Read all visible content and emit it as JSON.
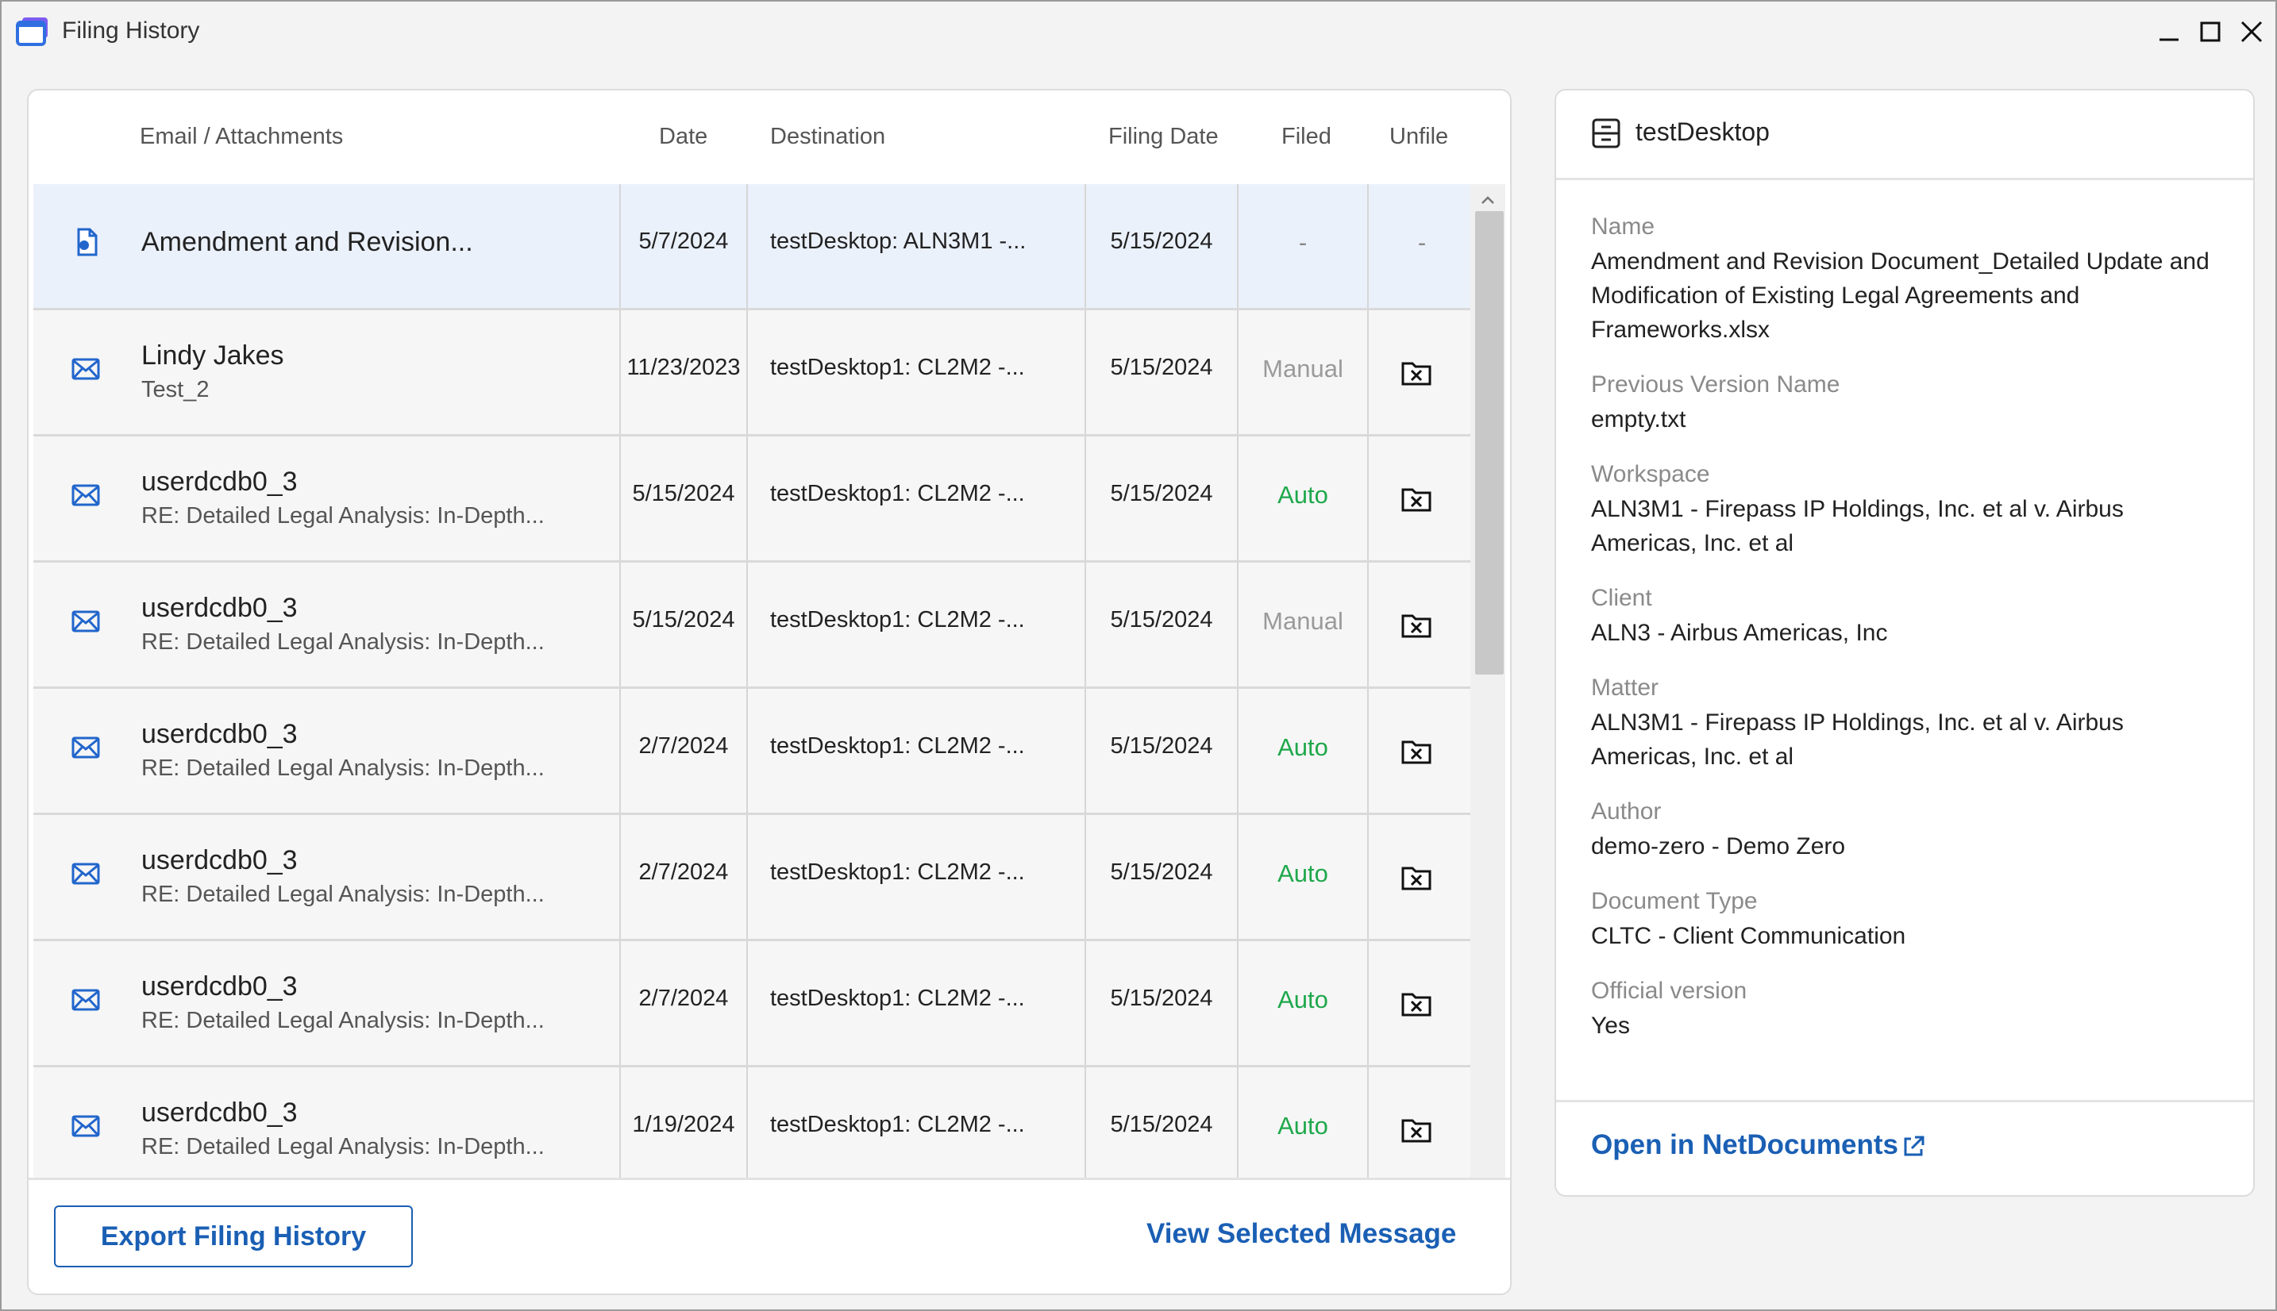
{
  "window": {
    "title": "Filing History"
  },
  "table": {
    "headers": {
      "email": "Email / Attachments",
      "date": "Date",
      "destination": "Destination",
      "filing_date": "Filing Date",
      "filed": "Filed",
      "unfile": "Unfile"
    },
    "rows": [
      {
        "type": "document",
        "name": "Amendment and Revision...",
        "sub": "",
        "date": "5/7/2024",
        "destination": "testDesktop: ALN3M1 -...",
        "filing_date": "5/15/2024",
        "filed": "-",
        "unfile": "-",
        "selected": true
      },
      {
        "type": "email",
        "name": "Lindy Jakes",
        "sub": "Test_2",
        "date": "11/23/2023",
        "destination": "testDesktop1: CL2M2 -...",
        "filing_date": "5/15/2024",
        "filed": "Manual",
        "unfile": "icon"
      },
      {
        "type": "email",
        "name": "userdcdb0_3",
        "sub": "RE: Detailed Legal Analysis: In-Depth...",
        "date": "5/15/2024",
        "destination": "testDesktop1: CL2M2 -...",
        "filing_date": "5/15/2024",
        "filed": "Auto",
        "unfile": "icon"
      },
      {
        "type": "email",
        "name": "userdcdb0_3",
        "sub": "RE: Detailed Legal Analysis: In-Depth...",
        "date": "5/15/2024",
        "destination": "testDesktop1: CL2M2 -...",
        "filing_date": "5/15/2024",
        "filed": "Manual",
        "unfile": "icon"
      },
      {
        "type": "email",
        "name": "userdcdb0_3",
        "sub": "RE: Detailed Legal Analysis: In-Depth...",
        "date": "2/7/2024",
        "destination": "testDesktop1: CL2M2 -...",
        "filing_date": "5/15/2024",
        "filed": "Auto",
        "unfile": "icon"
      },
      {
        "type": "email",
        "name": "userdcdb0_3",
        "sub": "RE: Detailed Legal Analysis: In-Depth...",
        "date": "2/7/2024",
        "destination": "testDesktop1: CL2M2 -...",
        "filing_date": "5/15/2024",
        "filed": "Auto",
        "unfile": "icon"
      },
      {
        "type": "email",
        "name": "userdcdb0_3",
        "sub": "RE: Detailed Legal Analysis: In-Depth...",
        "date": "2/7/2024",
        "destination": "testDesktop1: CL2M2 -...",
        "filing_date": "5/15/2024",
        "filed": "Auto",
        "unfile": "icon"
      },
      {
        "type": "email",
        "name": "userdcdb0_3",
        "sub": "RE: Detailed Legal Analysis: In-Depth...",
        "date": "1/19/2024",
        "destination": "testDesktop1: CL2M2 -...",
        "filing_date": "5/15/2024",
        "filed": "Auto",
        "unfile": "icon"
      }
    ]
  },
  "footer": {
    "export_label": "Export Filing History",
    "view_label": "View Selected Message"
  },
  "details": {
    "title": "testDesktop",
    "fields": [
      {
        "label": "Name",
        "value": "Amendment and Revision Document_Detailed Update and Modification of Existing Legal Agreements and Frameworks.xlsx"
      },
      {
        "label": "Previous Version Name",
        "value": "empty.txt"
      },
      {
        "label": "Workspace",
        "value": "ALN3M1 - Firepass IP Holdings, Inc. et al v. Airbus Americas, Inc. et al"
      },
      {
        "label": "Client",
        "value": "ALN3 - Airbus Americas, Inc"
      },
      {
        "label": "Matter",
        "value": "ALN3M1 - Firepass IP Holdings, Inc. et al v. Airbus Americas, Inc. et al"
      },
      {
        "label": "Author",
        "value": "demo-zero - Demo Zero"
      },
      {
        "label": "Document Type",
        "value": "CLTC - Client Communication"
      },
      {
        "label": "Official version",
        "value": "Yes"
      }
    ],
    "open_label": "Open in NetDocuments"
  },
  "colors": {
    "accent": "#1a5fb4",
    "auto": "#1ea84b",
    "manual": "#9a9a9a",
    "selected_row": "#ebf1fb"
  },
  "icons": {
    "app": "app-window-icon",
    "email": "envelope-icon",
    "document": "document-icon",
    "unfile": "folder-x-icon",
    "details": "cabinet-icon",
    "external": "external-link-icon"
  }
}
